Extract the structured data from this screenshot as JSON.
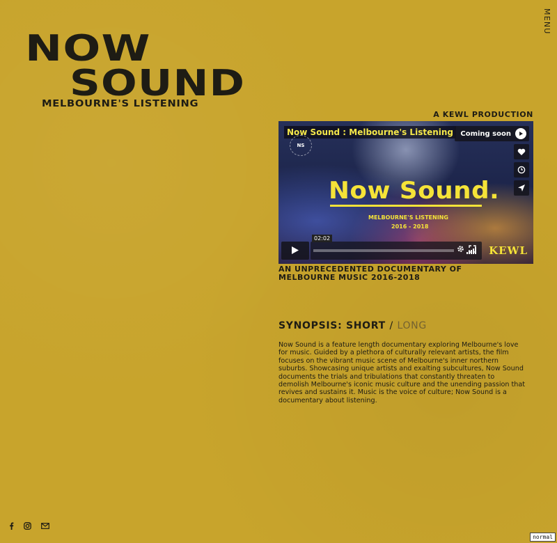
{
  "brand": {
    "line1": "NOW",
    "line2": "SOUND",
    "subtitle": "MELBOURNE'S LISTENING"
  },
  "nav": {
    "menu_label": "MENU"
  },
  "production_credit": "A KEWL PRODUCTION",
  "video": {
    "title": "Now Sound : Melbourne's Listening",
    "badge_text": "NS",
    "coming_soon_label": "Coming soon",
    "logo_text": "Now Sound.",
    "subtitle_line1": "MELBOURNE'S LISTENING",
    "subtitle_line2": "2016 - 2018",
    "duration": "02:02",
    "brand_mark": "KEWL",
    "side_buttons": [
      "heart-icon",
      "clock-icon",
      "share-icon"
    ]
  },
  "tagline": "AN UNPRECEDENTED DOCUMENTARY OF MELBOURNE MUSIC 2016-2018",
  "synopsis": {
    "heading_prefix": "SYNOPSIS:",
    "short_label": "SHORT",
    "separator": "/",
    "long_label": "LONG",
    "body": "Now Sound is a feature length documentary exploring Melbourne's love for music. Guided by a plethora of culturally relevant artists, the film focuses on the vibrant music scene of Melbourne's inner northern suburbs. Showcasing unique artists and exalting subcultures, Now Sound documents the trials and tribulations that constantly threaten to demolish Melbourne's iconic music culture and the unending passion that revives and sustains it. Music is the voice of culture; Now Sound is a documentary about listening."
  },
  "social": [
    "facebook-icon",
    "instagram-icon",
    "mail-icon"
  ],
  "status_badge": "normal",
  "colors": {
    "background": "#c8a42c",
    "text": "#1e1c14",
    "accent_yellow": "#f5e338",
    "muted": "#746230"
  }
}
